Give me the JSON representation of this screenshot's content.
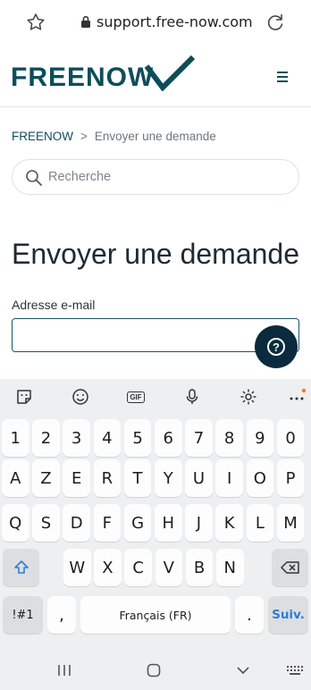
{
  "browser": {
    "url": "support.free-now.com",
    "icons": [
      "star-icon",
      "lock-icon",
      "reload-icon"
    ]
  },
  "site": {
    "logo_text": "FREENOW",
    "brand_color": "#0e4d5a",
    "menu_icon": "hamburger-icon"
  },
  "breadcrumb": {
    "home": "FREENOW",
    "separator": ">",
    "current": "Envoyer une demande"
  },
  "search": {
    "placeholder": "Recherche"
  },
  "page": {
    "title": "Envoyer une demande",
    "email_label": "Adresse e-mail",
    "email_value": "",
    "help_symbol": "?"
  },
  "keyboard": {
    "toolbar": [
      "sticker-icon",
      "emoji-icon",
      "gif-icon",
      "microphone-icon",
      "settings-icon",
      "more-icon"
    ],
    "gif_label": "GIF",
    "rows": [
      [
        "1",
        "2",
        "3",
        "4",
        "5",
        "6",
        "7",
        "8",
        "9",
        "0"
      ],
      [
        "A",
        "Z",
        "E",
        "R",
        "T",
        "Y",
        "U",
        "I",
        "O",
        "P"
      ],
      [
        "Q",
        "S",
        "D",
        "F",
        "G",
        "H",
        "J",
        "K",
        "L",
        "M"
      ],
      [
        "W",
        "X",
        "C",
        "V",
        "B",
        "N"
      ]
    ],
    "symbols_label": "!#1",
    "comma": ",",
    "space_label": "Français (FR)",
    "period": ".",
    "action_label": "Suiv.",
    "accent_color": "#2e7ed6"
  }
}
